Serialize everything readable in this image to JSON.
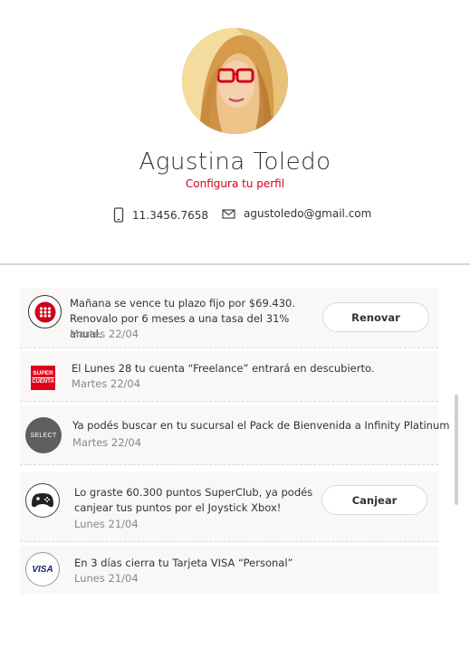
{
  "profile": {
    "name": "Agustina Toledo",
    "configure_link": "Configura tu perfil",
    "phone": "11.3456.7658",
    "email": "agustoledo@gmail.com"
  },
  "colors": {
    "accent": "#d0021b",
    "card_bg": "#f9f8f7",
    "muted_text": "#888888"
  },
  "notifications": [
    {
      "icon": "bank-dots-icon",
      "message_line1": "Mañana se vence tu plazo fijo por $69.430.",
      "message_line2": "Renovalo por 6 meses a una tasa del 31% anual.",
      "date": "Martes 22/04",
      "action": "Renovar"
    },
    {
      "icon": "supercuenta-logo",
      "logo_line1": "SUPER",
      "logo_line2": "CUENTA",
      "message_line1": "El Lunes 28 tu cuenta “Freelance” entrará en descubierto.",
      "date": "Martes 22/04"
    },
    {
      "icon": "select-logo",
      "logo_text": "SELECT",
      "message_line1": "Ya podés buscar en tu sucursal el Pack de Bienvenida a Infinity Platinum",
      "date": "Martes 22/04"
    },
    {
      "icon": "gamepad-icon",
      "message_line1": "Lo graste 60.300 puntos SuperClub, ya podés",
      "message_line2": "canjear tus puntos por el Joystick Xbox!",
      "date": "Lunes 21/04",
      "action": "Canjear"
    },
    {
      "icon": "visa-logo",
      "logo_text": "VISA",
      "message_line1": "En 3 días cierra tu Tarjeta VISA “Personal”",
      "date": "Lunes 21/04"
    }
  ]
}
